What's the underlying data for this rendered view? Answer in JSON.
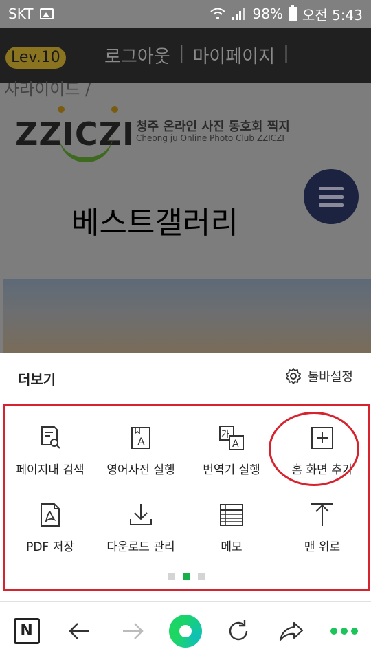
{
  "status_bar": {
    "carrier": "SKT",
    "battery": "98%",
    "time": "오전 5:43"
  },
  "site": {
    "level_badge": "Lev.10",
    "logout": "로그아웃",
    "mypage": "마이페이지",
    "cut_text": "사라이이드 /",
    "logo_text": "ZZICZI",
    "club_name_kr": "청주 온라인 사진 동호회 찍지",
    "club_name_en": "Cheong ju Online Photo Club ZZICZI",
    "page_title": "베스트갤러리"
  },
  "sheet": {
    "title": "더보기",
    "toolbar_settings": "툴바설정",
    "items": [
      {
        "label": "페이지내 검색",
        "icon": "page-search-icon"
      },
      {
        "label": "영어사전 실행",
        "icon": "dictionary-icon"
      },
      {
        "label": "번역기 실행",
        "icon": "translator-icon"
      },
      {
        "label": "홈 화면 추가",
        "icon": "add-home-icon"
      },
      {
        "label": "PDF 저장",
        "icon": "pdf-icon"
      },
      {
        "label": "다운로드 관리",
        "icon": "download-icon"
      },
      {
        "label": "메모",
        "icon": "memo-icon"
      },
      {
        "label": "맨 위로",
        "icon": "scroll-top-icon"
      }
    ],
    "pager": {
      "pages": 3,
      "active": 2
    }
  },
  "bottom_nav": {
    "n_label": "N"
  },
  "colors": {
    "highlight_red": "#d7232e",
    "accent_green": "#15b04a"
  }
}
